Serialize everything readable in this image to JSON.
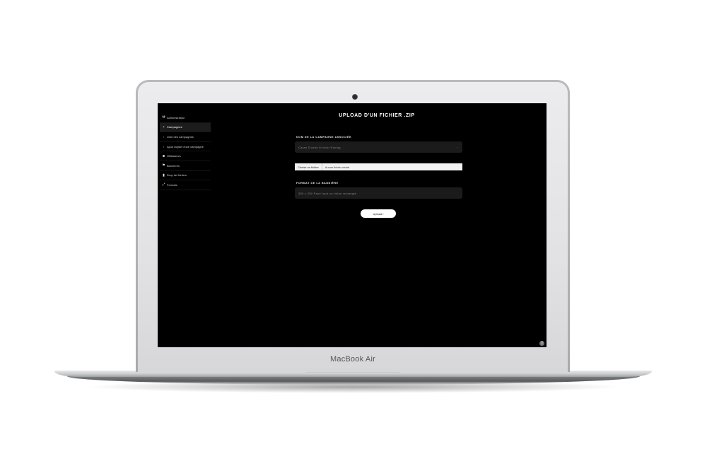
{
  "device": {
    "brand_label": "MacBook Air"
  },
  "sidebar": {
    "items": [
      {
        "label": "Administration",
        "icon": "tools-icon",
        "glyph": "⚒"
      },
      {
        "label": "Campagnes",
        "icon": "campaign-icon",
        "glyph": "▪",
        "active": true
      },
      {
        "label": "Liste des campagnes",
        "icon": "chevron-right-icon",
        "glyph": "›"
      },
      {
        "label": "Ajout rapide d'une campagne",
        "icon": "chevron-right-icon",
        "glyph": "›"
      },
      {
        "label": "Utilisateurs",
        "icon": "users-icon",
        "glyph": "☻"
      },
      {
        "label": "Bannières",
        "icon": "flag-icon",
        "glyph": "⚑"
      },
      {
        "label": "Drop de fichiers",
        "icon": "file-icon",
        "glyph": "▮"
      },
      {
        "label": "Formats",
        "icon": "resize-icon",
        "glyph": "⤢"
      }
    ]
  },
  "main": {
    "title": "UPLOAD D'UN FICHIER .ZIP",
    "campaign_label": "Nom de la campagne associée",
    "campaign_value": "Caran D'ache Ecridor Racing",
    "file_button": "Choisir un fichier",
    "file_status": "Aucun fichier choisi",
    "format_label": "Format de la bannière",
    "format_value": "300 x 250 Pavé haut ou Inline rectangle",
    "upload_button": "Upload !"
  },
  "colors": {
    "screen_bg": "#000000",
    "field_bg": "#1b1b1b",
    "active_nav": "#1c1c1c",
    "button_bg": "#ffffff"
  }
}
